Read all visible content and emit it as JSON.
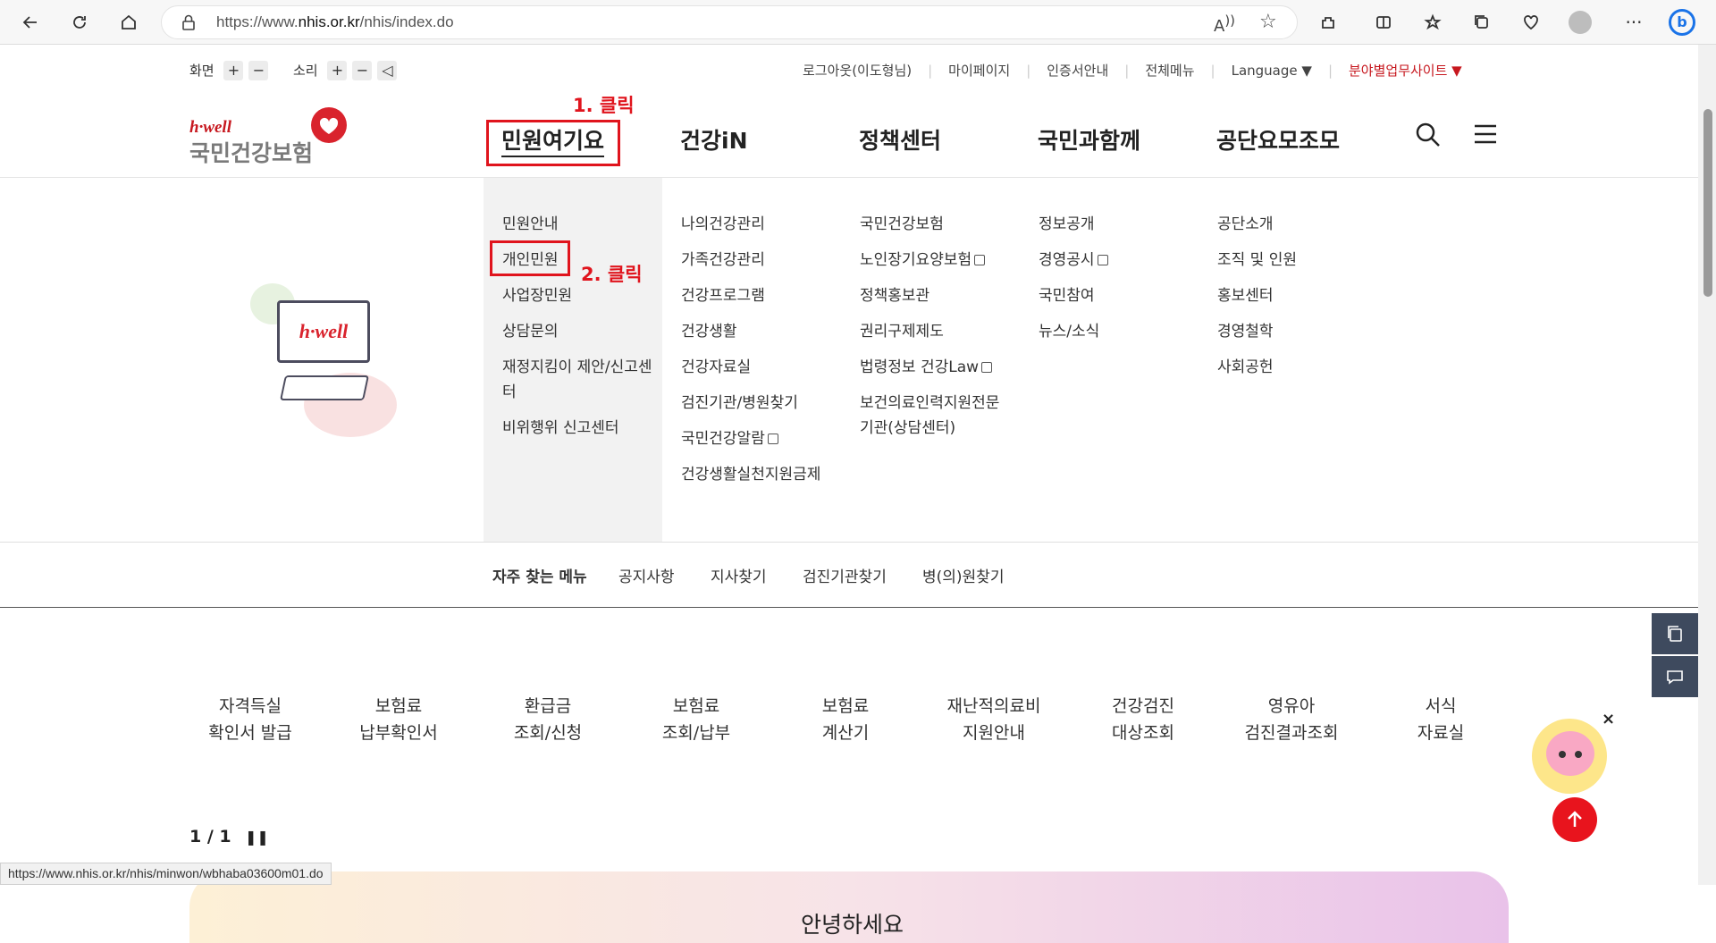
{
  "browser": {
    "url_prefix": "https://www.",
    "url_domain": "nhis.or.kr",
    "url_path": "/nhis/index.do",
    "status_url": "https://www.nhis.or.kr/nhis/minwon/wbhaba03600m01.do"
  },
  "utility": {
    "screen_label": "화면",
    "sound_label": "소리",
    "plus": "+",
    "minus": "−"
  },
  "top_links": [
    "로그아웃(이도형님)",
    "마이페이지",
    "인증서안내",
    "전체메뉴",
    "Language ▼",
    "분야별업무사이트 ▼"
  ],
  "logo": {
    "sub": "h·well",
    "main": "국민건강보험",
    "illustration_text": "h·well"
  },
  "gnb": [
    "민원여기요",
    "건강iN",
    "정책센터",
    "국민과함께",
    "공단요모조모"
  ],
  "annotations": {
    "step1": "1. 클릭",
    "step2": "2. 클릭"
  },
  "mega_menu": {
    "col1": [
      "민원안내",
      "개인민원",
      "사업장민원",
      "상담문의",
      "재정지킴이 제안/신고센터",
      "비위행위 신고센터"
    ],
    "col2": [
      "나의건강관리",
      "가족건강관리",
      "건강프로그램",
      "건강생활",
      "건강자료실",
      "검진기관/병원찾기",
      "국민건강알람",
      "건강생활실천지원금제"
    ],
    "col3": [
      "국민건강보험",
      "노인장기요양보험",
      "정책홍보관",
      "권리구제제도",
      "법령정보 건강Law",
      "보건의료인력지원전문기관(상담센터)"
    ],
    "col4": [
      "정보공개",
      "경영공시",
      "국민참여",
      "뉴스/소식"
    ],
    "col5": [
      "공단소개",
      "조직 및 인원",
      "홍보센터",
      "경영철학",
      "사회공헌"
    ]
  },
  "frequent": {
    "title": "자주 찾는 메뉴",
    "items": [
      "공지사항",
      "지사찾기",
      "검진기관찾기",
      "병(의)원찾기"
    ]
  },
  "quick_menu": [
    [
      "자격득실",
      "확인서 발급"
    ],
    [
      "보험료",
      "납부확인서"
    ],
    [
      "환급금",
      "조회/신청"
    ],
    [
      "보험료",
      "조회/납부"
    ],
    [
      "보험료",
      "계산기"
    ],
    [
      "재난적의료비",
      "지원안내"
    ],
    [
      "건강검진",
      "대상조회"
    ],
    [
      "영유아",
      "검진결과조회"
    ],
    [
      "서식",
      "자료실"
    ]
  ],
  "pager": {
    "text": "1 / 1"
  },
  "banner": {
    "greeting": "안녕하세요"
  },
  "close_glyph": "×"
}
